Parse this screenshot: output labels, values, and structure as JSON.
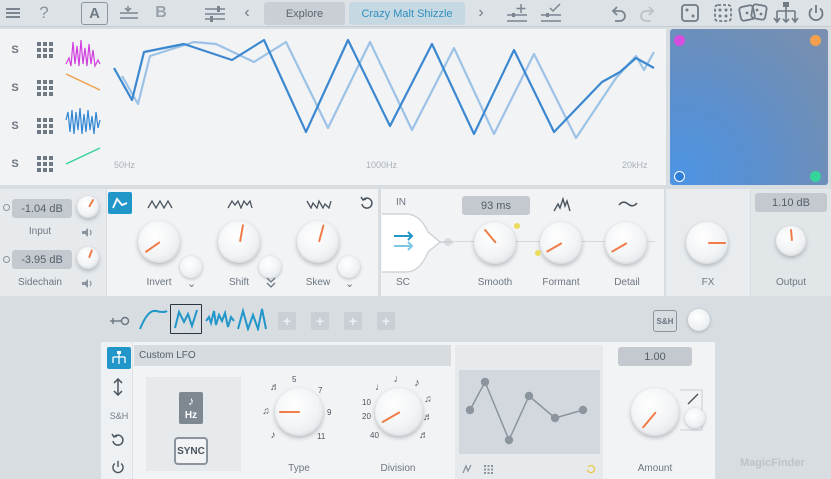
{
  "toolbar": {
    "ab_a": "A",
    "ab_b": "B",
    "prev": "‹",
    "next": "›",
    "explore_label": "Explore",
    "preset_name": "Crazy Malt Shizzle"
  },
  "spectrum": {
    "solo_labels": [
      "S",
      "S",
      "S",
      "S"
    ],
    "freq_labels": [
      "50Hz",
      "1000Hz",
      "20kHz"
    ]
  },
  "xy_pad": {
    "corner_colors": [
      "#d64ee0",
      "#f3a04e",
      "#2f7fd9",
      "#35d49a"
    ]
  },
  "input": {
    "input_value": "-1.04 dB",
    "input_label": "Input",
    "sidechain_value": "-3.95 dB",
    "sidechain_label": "Sidechain"
  },
  "morph": {
    "invert_label": "Invert",
    "shift_label": "Shift",
    "skew_label": "Skew"
  },
  "formant": {
    "in_label": "IN",
    "sc_label": "SC",
    "smooth_value": "93 ms",
    "smooth_label": "Smooth",
    "formant_label": "Formant",
    "detail_label": "Detail"
  },
  "fx": {
    "fx_label": "FX"
  },
  "output": {
    "value": "1.10 dB",
    "label": "Output"
  },
  "lfo": {
    "sh_label": "S&H",
    "title": "Custom LFO",
    "side_sh_label": "S&H",
    "hz_label": "Hz",
    "sync_label": "SYNC",
    "type_label": "Type",
    "type_marks": [
      "5",
      "7",
      "9",
      "11"
    ],
    "division_label": "Division",
    "division_marks": [
      "10",
      "20",
      "40"
    ],
    "amount_value": "1.00",
    "amount_label": "Amount"
  },
  "watermark": "MagicFinder",
  "colors": {
    "accent": "#2196c9",
    "knob_tick": "#ef7d49",
    "curve_dark": "#3c88d0",
    "curve_light": "#9cc2e6"
  }
}
